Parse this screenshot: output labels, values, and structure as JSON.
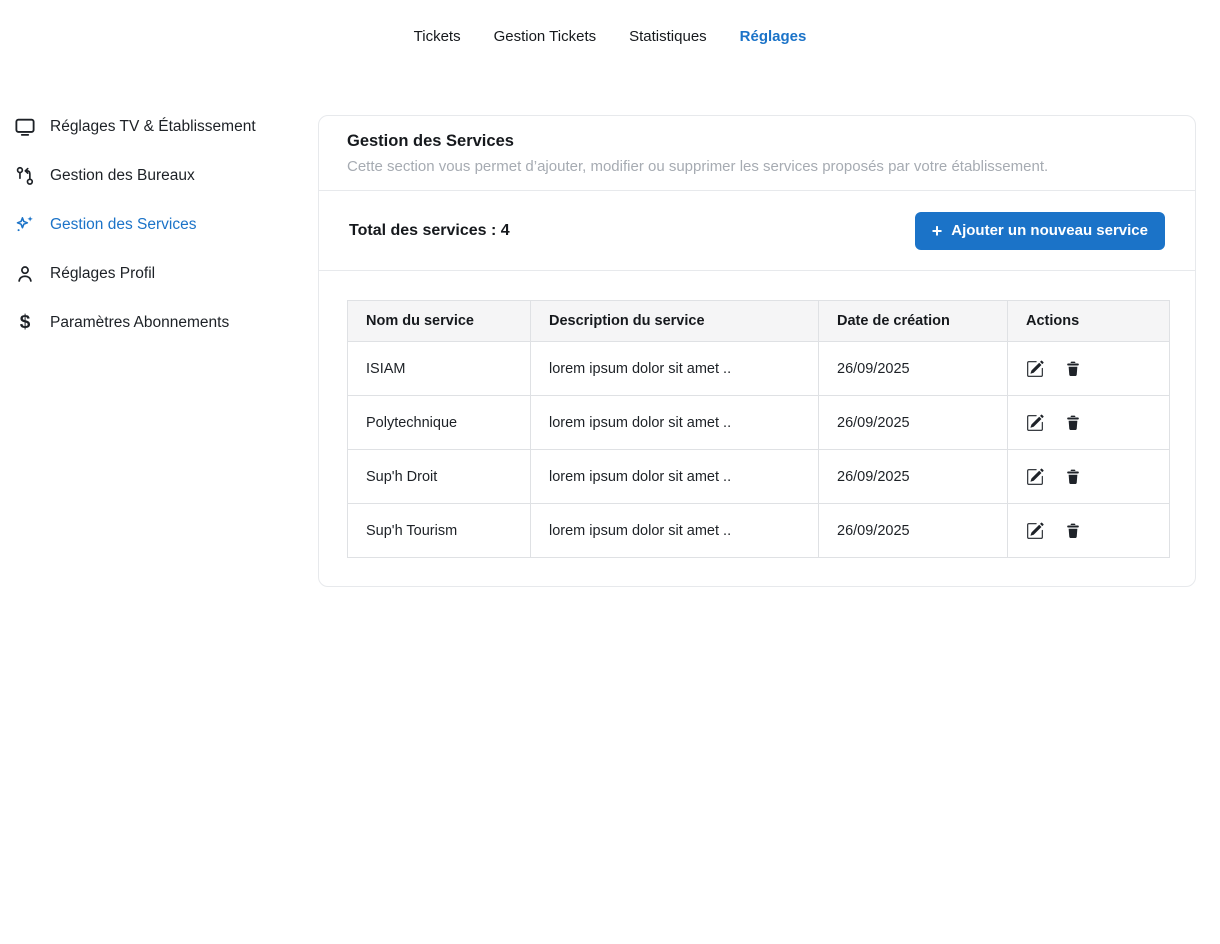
{
  "colors": {
    "accent": "#1b73c8",
    "text": "#1d2126",
    "muted": "#a6abb2",
    "card_border": "#e7e9ec",
    "table_border": "#dfe1e4",
    "table_header_bg": "#f5f5f6"
  },
  "topnav": {
    "items": [
      {
        "label": "Tickets",
        "active": false
      },
      {
        "label": "Gestion Tickets",
        "active": false
      },
      {
        "label": "Statistiques",
        "active": false
      },
      {
        "label": "Réglages",
        "active": true
      }
    ]
  },
  "sidebar": {
    "items": [
      {
        "icon": "tv-icon",
        "label": "Réglages TV & Établissement",
        "active": false
      },
      {
        "icon": "route-icon",
        "label": "Gestion des Bureaux",
        "active": false
      },
      {
        "icon": "sparkles-icon",
        "label": "Gestion des Services",
        "active": true
      },
      {
        "icon": "person-icon",
        "label": "Réglages Profil",
        "active": false
      },
      {
        "icon": "dollar-icon",
        "label": "Paramètres Abonnements",
        "active": false
      }
    ]
  },
  "icons": {
    "dollar": "$",
    "plus": "+"
  },
  "content": {
    "title": "Gestion des Services",
    "subtitle": "Cette section vous permet d’ajouter, modifier ou supprimer les services proposés par votre établissement.",
    "total_label": "Total des services :",
    "total_count": "4",
    "add_button_label": "Ajouter un nouveau service",
    "table": {
      "columns": [
        "Nom du service",
        "Description du service",
        "Date de création",
        "Actions"
      ],
      "rows": [
        {
          "name": "ISIAM",
          "description": "lorem ipsum dolor sit amet ..",
          "date": "26/09/2025"
        },
        {
          "name": "Polytechnique",
          "description": "lorem ipsum dolor sit amet ..",
          "date": "26/09/2025"
        },
        {
          "name": "Sup'h Droit",
          "description": "lorem ipsum dolor sit amet ..",
          "date": "26/09/2025"
        },
        {
          "name": "Sup'h Tourism",
          "description": "lorem ipsum dolor sit amet ..",
          "date": "26/09/2025"
        }
      ]
    }
  }
}
